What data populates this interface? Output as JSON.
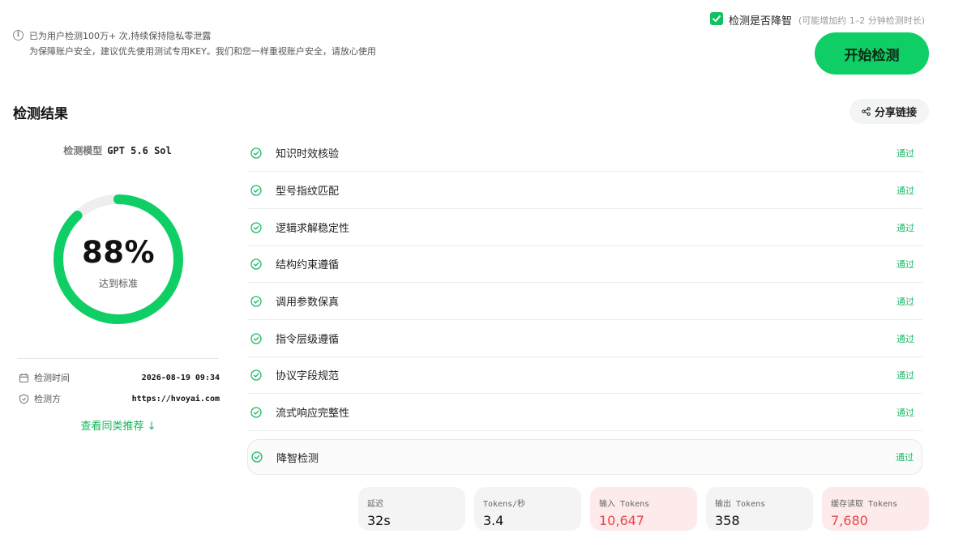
{
  "notice": {
    "icon": "info-icon",
    "line1": "已为用户检测100万+ 次,持续保持隐私零泄露",
    "line2": "为保障账户安全，建议优先使用测试专用KEY。我们和您一样重视账户安全，请放心使用"
  },
  "degrade_option": {
    "checked": true,
    "label": "检测是否降智",
    "hint": "(可能增加约 1–2 分钟检测时长)"
  },
  "start_button": "开始检测",
  "section_title": "检测结果",
  "share_button": "分享链接",
  "model": {
    "label": "检测模型",
    "name": "GPT 5.6 Sol"
  },
  "score": {
    "value": "88%",
    "fraction": 0.88,
    "caption": "达到标准"
  },
  "meta": {
    "time_label": "检测时间",
    "time_value": "2026-08-19 09:34",
    "source_label": "检测方",
    "source_value": "https://hvoyai.com"
  },
  "similar_link": "查看同类推荐 ↓",
  "checks": [
    {
      "name": "知识时效核验",
      "status": "通过"
    },
    {
      "name": "型号指纹匹配",
      "status": "通过"
    },
    {
      "name": "逻辑求解稳定性",
      "status": "通过"
    },
    {
      "name": "结构约束遵循",
      "status": "通过"
    },
    {
      "name": "调用参数保真",
      "status": "通过"
    },
    {
      "name": "指令层级遵循",
      "status": "通过"
    },
    {
      "name": "协议字段规范",
      "status": "通过"
    },
    {
      "name": "流式响应完整性",
      "status": "通过"
    }
  ],
  "degrade_check": {
    "name": "降智检测",
    "status": "通过"
  },
  "stats": [
    {
      "label": "延迟",
      "value": "32s"
    },
    {
      "label": "Tokens/秒",
      "value": "3.4"
    },
    {
      "label": "输入 Tokens",
      "value": "10,647"
    },
    {
      "label": "输出 Tokens",
      "value": "358"
    },
    {
      "label": "缓存读取 Tokens",
      "value": "7,680"
    }
  ],
  "colors": {
    "accent": "#0fce65",
    "pass_text": "#1db865",
    "highlight_red": "#e5484d"
  }
}
